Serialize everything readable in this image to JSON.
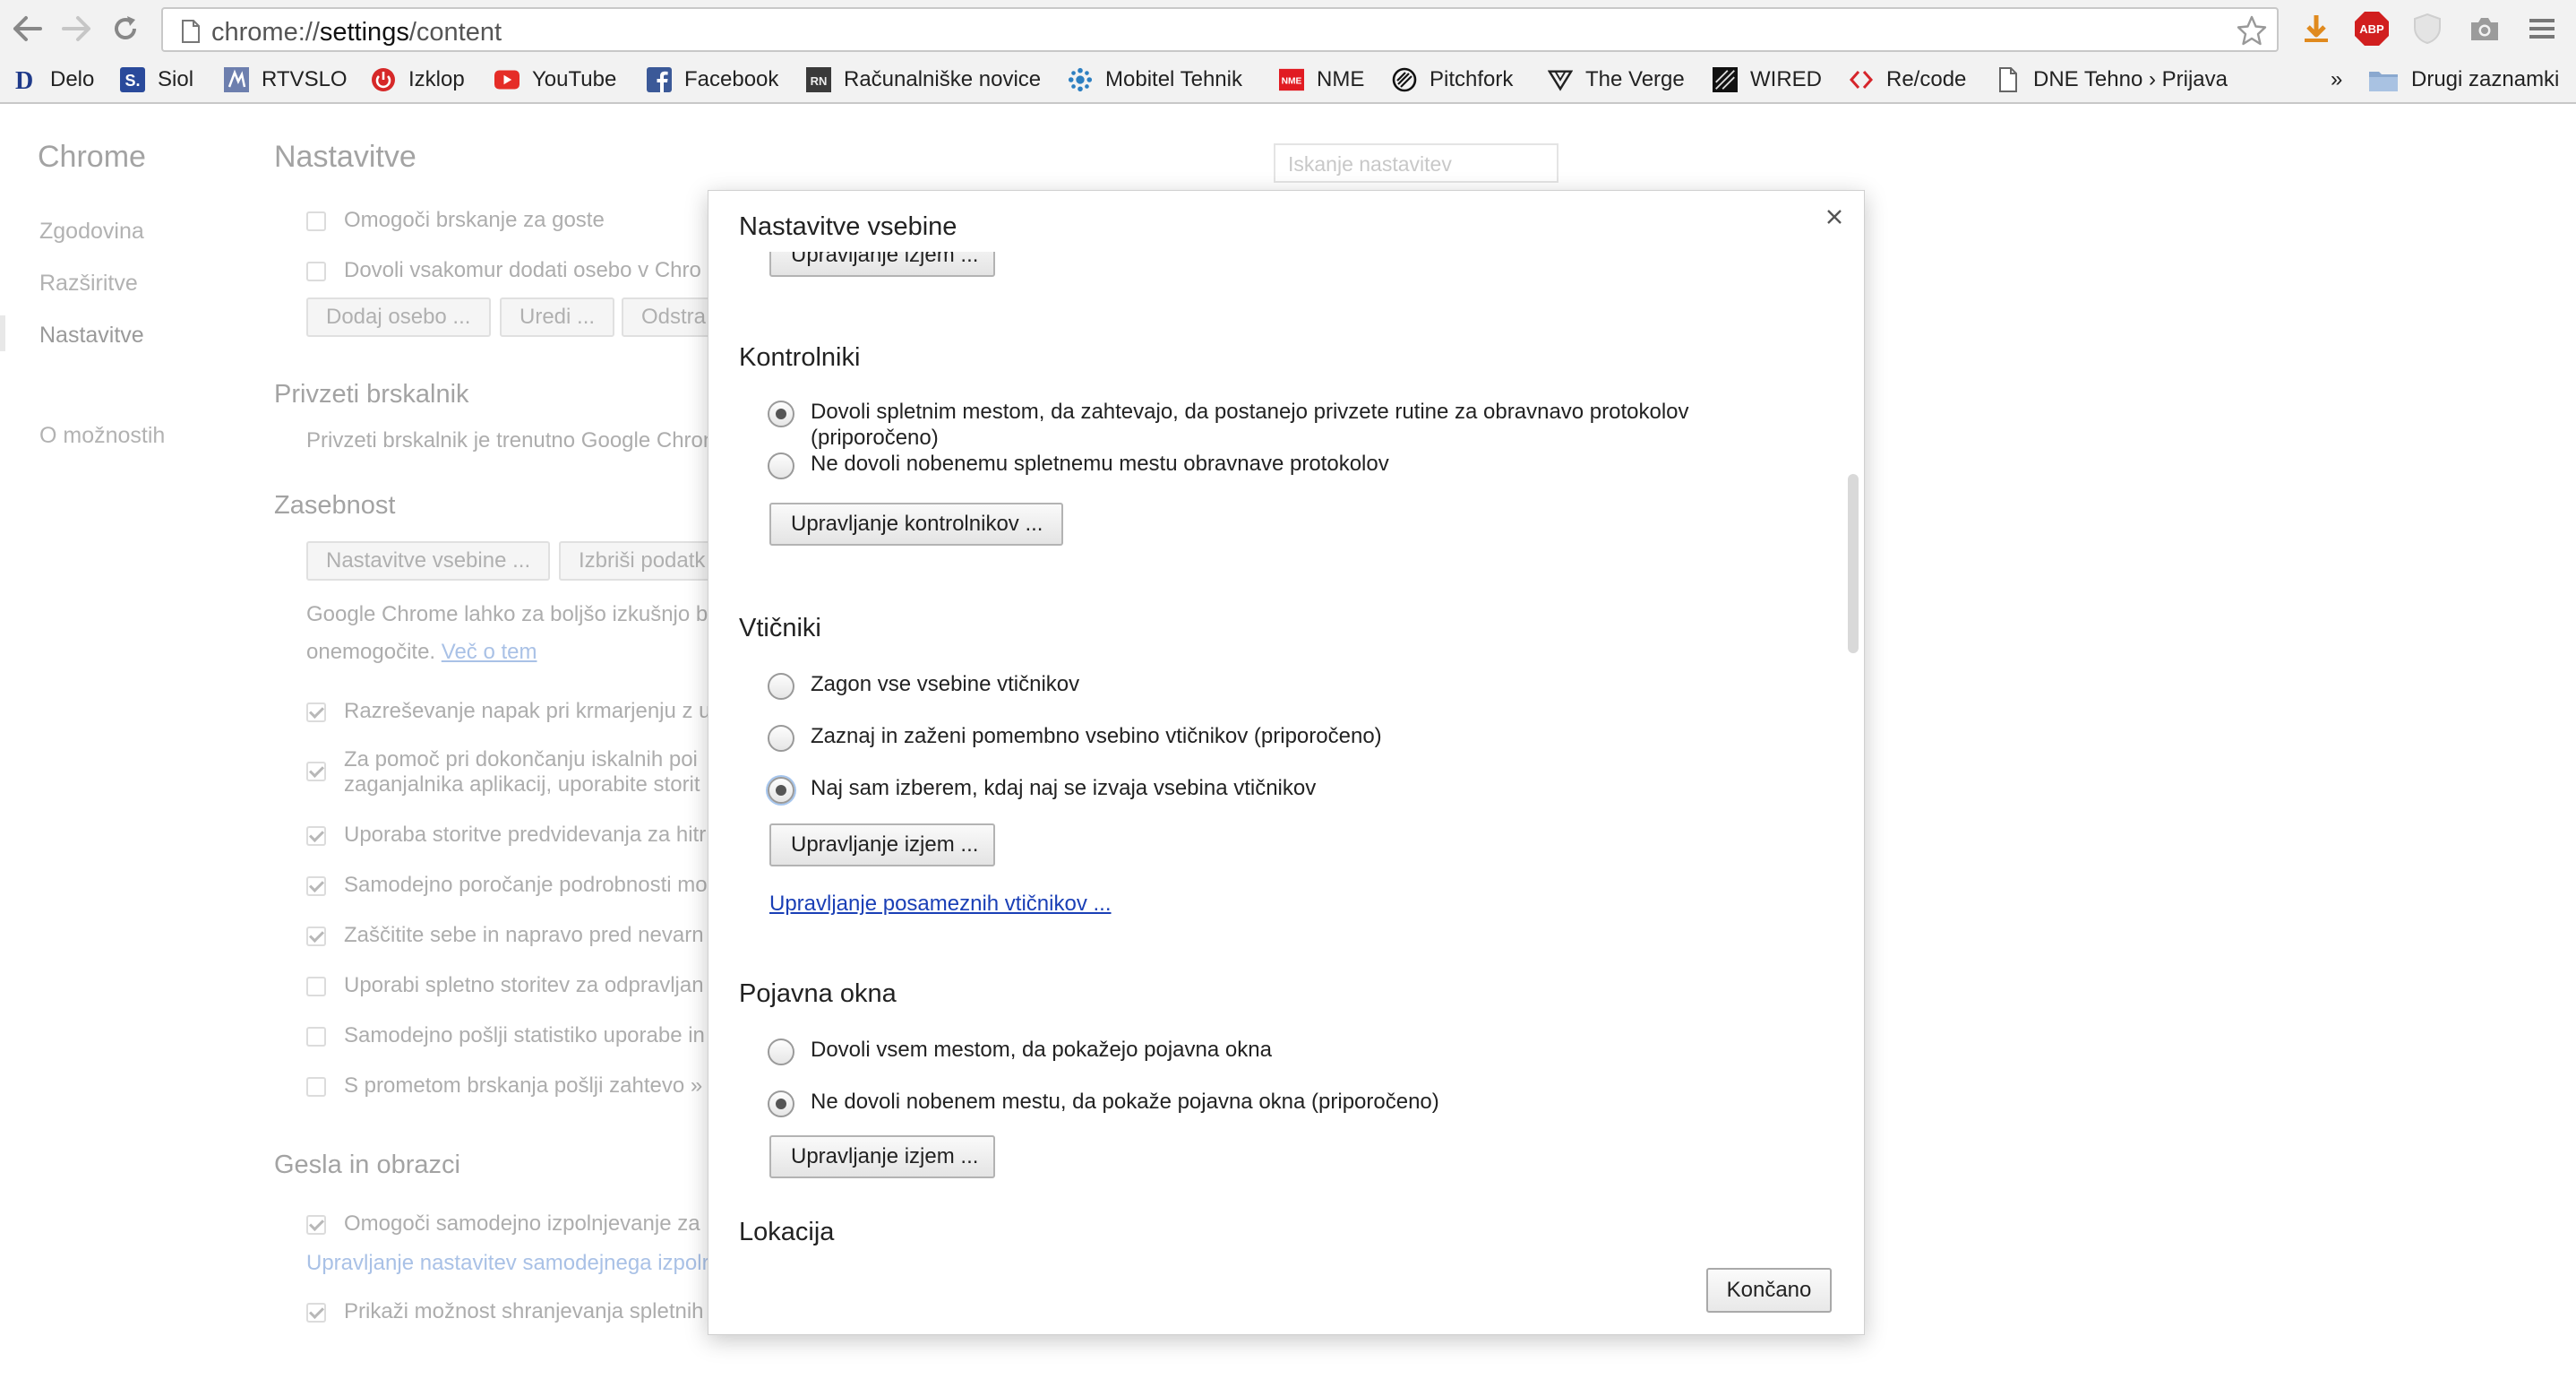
{
  "browser": {
    "url_prefix": "chrome://",
    "url_host": "settings",
    "url_path": "/content"
  },
  "bookmarks": [
    {
      "label": "Delo",
      "icon": "delo-icon"
    },
    {
      "label": "Siol",
      "icon": "siol-icon"
    },
    {
      "label": "RTVSLO",
      "icon": "rtvslo-icon"
    },
    {
      "label": "Izklop",
      "icon": "izklop-icon"
    },
    {
      "label": "YouTube",
      "icon": "youtube-icon"
    },
    {
      "label": "Facebook",
      "icon": "facebook-icon"
    },
    {
      "label": "Računalniške novice",
      "icon": "racunalniske-novice-icon"
    },
    {
      "label": "Mobitel Tehnik",
      "icon": "mobitel-icon"
    },
    {
      "label": "NME",
      "icon": "nme-icon"
    },
    {
      "label": "Pitchfork",
      "icon": "pitchfork-icon"
    },
    {
      "label": "The Verge",
      "icon": "verge-icon"
    },
    {
      "label": "WIRED",
      "icon": "wired-icon"
    },
    {
      "label": "Re/code",
      "icon": "recode-icon"
    },
    {
      "label": "DNE Tehno › Prijava",
      "icon": "page-icon"
    }
  ],
  "bookmarks_overflow": "»",
  "other_bookmarks": "Drugi zaznamki",
  "settings": {
    "brand": "Chrome",
    "title": "Nastavitve",
    "search_placeholder": "Iskanje nastavitev",
    "nav": [
      "Zgodovina",
      "Razširitve",
      "Nastavitve",
      "O možnostih"
    ],
    "people": {
      "guest": "Omogoči brskanje za goste",
      "add_anyone": "Dovoli vsakomur dodati osebo v Chro",
      "btn_add": "Dodaj osebo ...",
      "btn_edit": "Uredi ...",
      "btn_remove": "Odstra"
    },
    "default_browser": {
      "heading": "Privzeti brskalnik",
      "text": "Privzeti brskalnik je trenutno Google Chron"
    },
    "privacy": {
      "heading": "Zasebnost",
      "btn_content": "Nastavitve vsebine ...",
      "btn_clear": "Izbriši podatk",
      "desc1": "Google Chrome lahko za boljšo izkušnjo b",
      "desc2": "onemogočite.",
      "learn_more": "Več o tem",
      "items": [
        {
          "label": "Razreševanje napak pri krmarjenju z u",
          "checked": true
        },
        {
          "label": "Za pomoč pri dokončanju iskalnih poi",
          "label2": "zaganjalnika aplikacij, uporabite storit",
          "checked": true
        },
        {
          "label": "Uporaba storitve predvidevanja za hitr",
          "checked": true
        },
        {
          "label": "Samodejno poročanje podrobnosti mo",
          "checked": true
        },
        {
          "label": "Zaščitite sebe in napravo pred nevarn",
          "checked": true
        },
        {
          "label": "Uporabi spletno storitev za odpravljan",
          "checked": false
        },
        {
          "label": "Samodejno pošlji statistiko uporabe in",
          "checked": false
        },
        {
          "label": "S prometom brskanja pošlji zahtevo »",
          "checked": false
        }
      ]
    },
    "passwords": {
      "heading": "Gesla in obrazci",
      "autofill": "Omogoči samodejno izpolnjevanje za",
      "manage_autofill": "Upravljanje nastavitev samodejnega izpolr",
      "offer_save": "Prikaži možnost shranjevanja spletnih"
    }
  },
  "dialog": {
    "title": "Nastavitve vsebine",
    "close": "×",
    "top_cut_button": "Upravljanje izjem ...",
    "handlers": {
      "heading": "Kontrolniki",
      "options": [
        {
          "label": "Dovoli spletnim mestom, da zahtevajo, da postanejo privzete rutine za obravnavo protokolov",
          "label2": "(priporočeno)",
          "selected": true
        },
        {
          "label": "Ne dovoli nobenemu spletnemu mestu obravnave protokolov",
          "selected": false
        }
      ],
      "button": "Upravljanje kontrolnikov ..."
    },
    "plugins": {
      "heading": "Vtičniki",
      "options": [
        {
          "label": "Zagon vse vsebine vtičnikov",
          "selected": false
        },
        {
          "label": "Zaznaj in zaženi pomembno vsebino vtičnikov (priporočeno)",
          "selected": false
        },
        {
          "label": "Naj sam izberem, kdaj naj se izvaja vsebina vtičnikov",
          "selected": true
        }
      ],
      "button": "Upravljanje izjem ...",
      "link": "Upravljanje posameznih vtičnikov ..."
    },
    "popups": {
      "heading": "Pojavna okna",
      "options": [
        {
          "label": "Dovoli vsem mestom, da pokažejo pojavna okna",
          "selected": false
        },
        {
          "label": "Ne dovoli nobenem mestu, da pokaže pojavna okna (priporočeno)",
          "selected": true
        }
      ],
      "button": "Upravljanje izjem ..."
    },
    "location": {
      "heading": "Lokacija"
    },
    "done": "Končano"
  }
}
